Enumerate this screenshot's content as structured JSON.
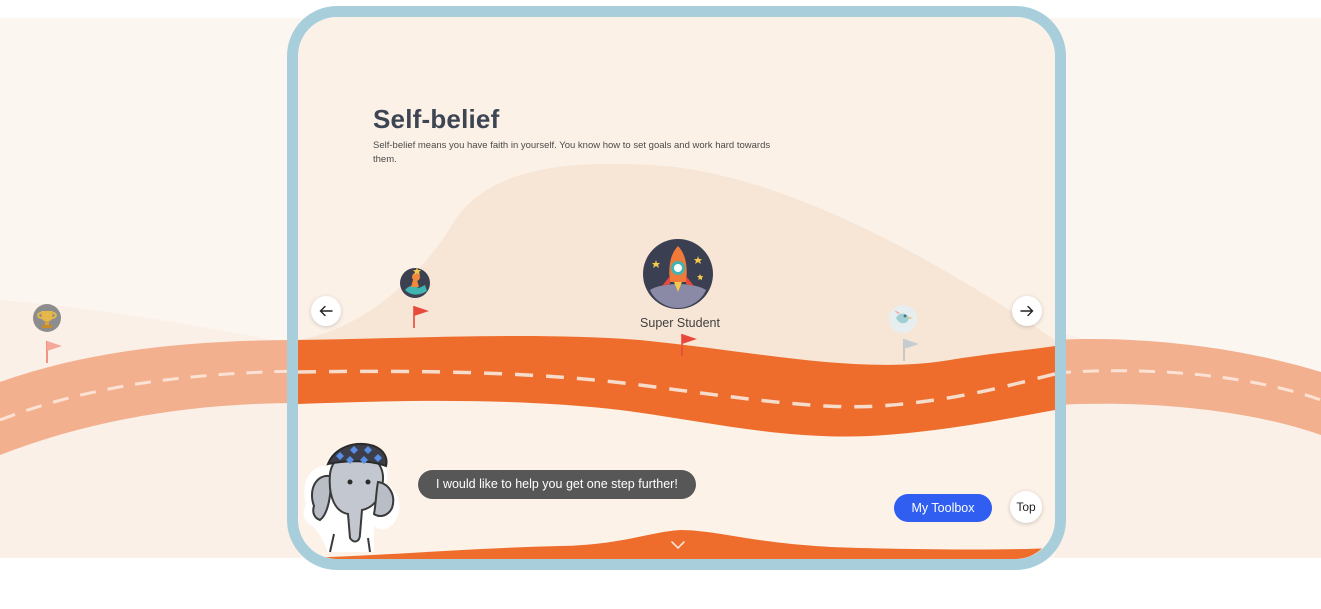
{
  "section": {
    "title": "Self-belief",
    "description": "Self-belief means you have faith in yourself. You know how to set goals and work hard towards them."
  },
  "badges": [
    {
      "name": "trophy-badge",
      "state": "completed",
      "flag_color": "#f07a6a"
    },
    {
      "name": "climber-badge",
      "state": "completed",
      "flag_color": "#e8493c"
    },
    {
      "name": "rocket-badge",
      "label": "Super Student",
      "state": "current",
      "flag_color": "#e8493c"
    },
    {
      "name": "bird-badge",
      "state": "locked",
      "flag_color": "#b9c0c6"
    }
  ],
  "navigation": {
    "prev_icon": "arrow-left-icon",
    "next_icon": "arrow-right-icon",
    "scroll_down_icon": "chevron-down-icon"
  },
  "mascot": {
    "name": "elephant-mascot",
    "message": "I would like to help you get one step further!"
  },
  "buttons": {
    "toolbox_label": "My Toolbox",
    "top_label": "Top"
  },
  "colors": {
    "road_orange": "#ee6d2c",
    "road_faded": "#f3b08e",
    "frame_blue": "#a9cedb",
    "button_blue": "#2f5ef0",
    "background_cream": "#fbf1e7",
    "flag_red": "#e8493c"
  }
}
